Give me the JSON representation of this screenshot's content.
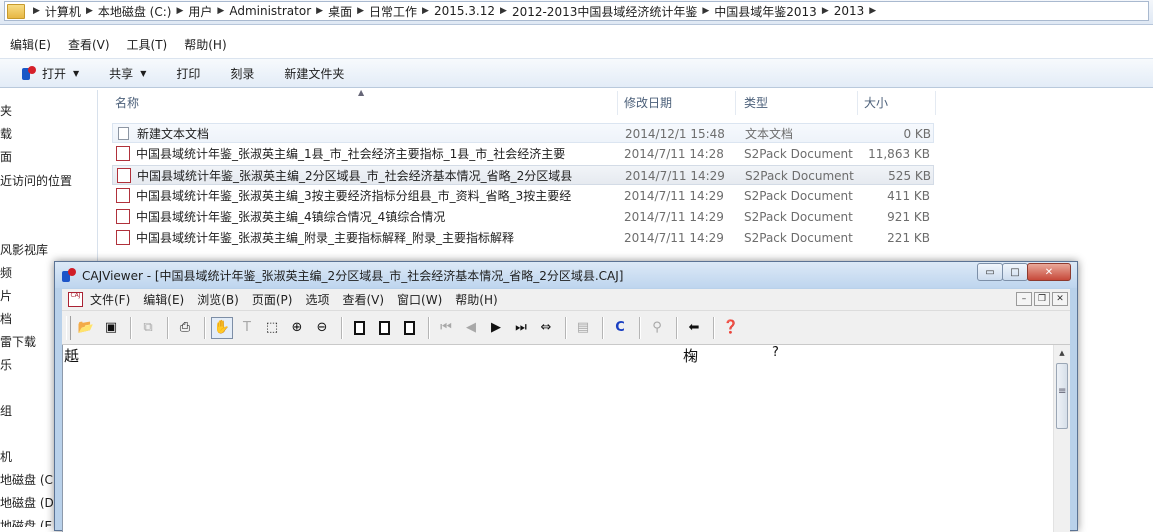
{
  "explorer": {
    "breadcrumbs": [
      "计算机",
      "本地磁盘 (C:)",
      "用户",
      "Administrator",
      "桌面",
      "日常工作",
      "2015.3.12",
      "2012-2013中国县域经济统计年鉴",
      "中国县域年鉴2013",
      "2013"
    ],
    "menu": [
      "编辑(E)",
      "查看(V)",
      "工具(T)",
      "帮助(H)"
    ],
    "toolbar": {
      "open": "打开",
      "share": "共享",
      "print": "打印",
      "burn": "刻录",
      "new_folder": "新建文件夹"
    },
    "nav_items": [
      "夹",
      "载",
      "面",
      "近访问的位置",
      "风影视库",
      "频",
      "片",
      "档",
      "雷下载",
      "乐",
      "组",
      "机",
      "地磁盘 (C",
      "地磁盘 (D",
      "地磁盘 (E"
    ],
    "columns": {
      "name": "名称",
      "date": "修改日期",
      "type": "类型",
      "size": "大小"
    },
    "files": [
      {
        "name": "新建文本文档",
        "date": "2014/12/1 15:48",
        "type": "文本文档",
        "size": "0 KB",
        "icon": "text-file-icon"
      },
      {
        "name": "中国县域统计年鉴_张淑英主编_1县_市_社会经济主要指标_1县_市_社会经济主要",
        "date": "2014/7/11 14:28",
        "type": "S2Pack Document",
        "size": "11,863 KB",
        "icon": "caj-file-icon"
      },
      {
        "name": "中国县域统计年鉴_张淑英主编_2分区域县_市_社会经济基本情况_省略_2分区域县",
        "date": "2014/7/11 14:29",
        "type": "S2Pack Document",
        "size": "525 KB",
        "icon": "caj-file-icon"
      },
      {
        "name": "中国县域统计年鉴_张淑英主编_3按主要经济指标分组县_市_资料_省略_3按主要经",
        "date": "2014/7/11 14:29",
        "type": "S2Pack Document",
        "size": "411 KB",
        "icon": "caj-file-icon"
      },
      {
        "name": "中国县域统计年鉴_张淑英主编_4镇综合情况_4镇综合情况",
        "date": "2014/7/11 14:29",
        "type": "S2Pack Document",
        "size": "921 KB",
        "icon": "caj-file-icon"
      },
      {
        "name": "中国县域统计年鉴_张淑英主编_附录_主要指标解释_附录_主要指标解释",
        "date": "2014/7/11 14:29",
        "type": "S2Pack Document",
        "size": "221 KB",
        "icon": "caj-file-icon"
      }
    ]
  },
  "cajviewer": {
    "title": "CAJViewer - [中国县域统计年鉴_张淑英主编_2分区域县_市_社会经济基本情况_省略_2分区域县.CAJ]",
    "doc_icon_label": "CAJ",
    "menu": [
      "文件(F)",
      "编辑(E)",
      "浏览(B)",
      "页面(P)",
      "选项",
      "查看(V)",
      "窗口(W)",
      "帮助(H)"
    ],
    "toolbar_icons": [
      "open-folder-icon",
      "save-icon",
      "copy-icon",
      "print-icon",
      "hand-tool-icon",
      "text-select-icon",
      "region-select-icon",
      "zoom-in-icon",
      "zoom-out-icon",
      "single-page-icon",
      "continuous-page-icon",
      "facing-page-icon",
      "first-page-icon",
      "prev-page-icon",
      "next-page-icon",
      "last-page-icon",
      "fit-width-icon",
      "layout-icon",
      "ocr-icon",
      "find-icon",
      "back-icon",
      "help-icon"
    ],
    "ocr_glyph": "C",
    "content_text": [
      "赿",
      "椈",
      "?"
    ]
  }
}
